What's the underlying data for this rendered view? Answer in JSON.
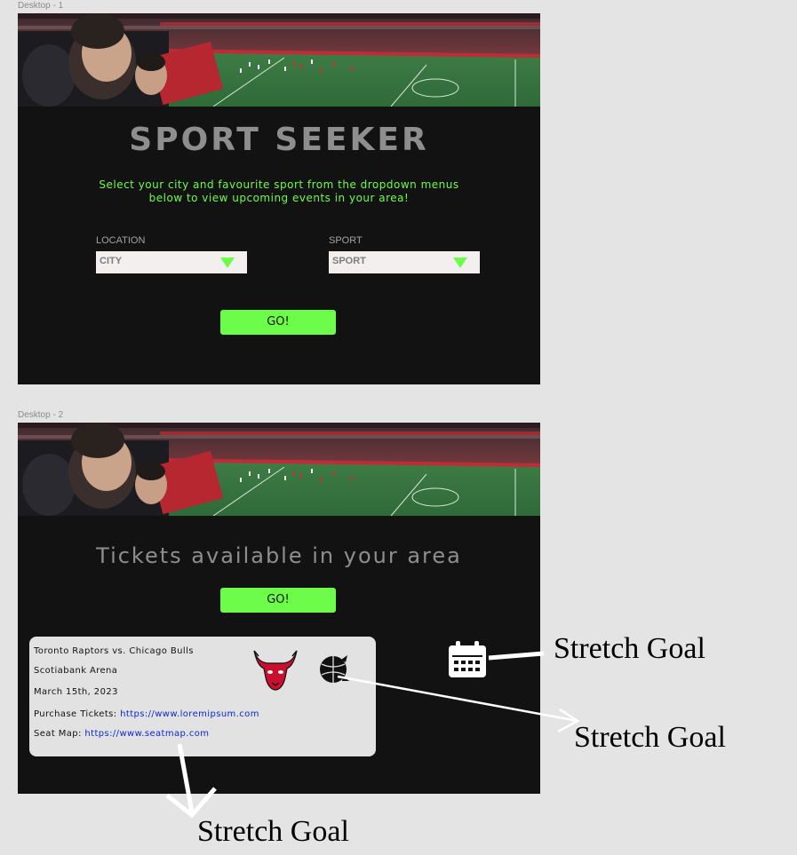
{
  "frames": [
    {
      "label": "Desktop - 1"
    },
    {
      "label": "Desktop - 2"
    }
  ],
  "desktop1": {
    "title": "SPORT SEEKER",
    "intro": "Select your city and favourite sport from the dropdown menus below to view upcoming events in your area!",
    "location": {
      "label": "LOCATION",
      "value": "CITY"
    },
    "sport": {
      "label": "SPORT",
      "value": "SPORT"
    },
    "go_label": "GO!"
  },
  "desktop2": {
    "title": "Tickets available in your area",
    "go_label": "GO!",
    "event": {
      "matchup": "Toronto Raptors vs. Chicago Bulls",
      "venue": "Scotiabank Arena",
      "date": "March 15th, 2023",
      "tickets_label": "Purchase Tickets:",
      "tickets_url": "https://www.loremipsum.com",
      "seatmap_label": "Seat Map:",
      "seatmap_url": "https://www.seatmap.com"
    },
    "icons": [
      "bulls-logo-icon",
      "raptors-logo-icon",
      "calendar-icon"
    ]
  },
  "annotations": [
    {
      "text": "Stretch Goal"
    },
    {
      "text": "Stretch Goal"
    },
    {
      "text": "Stretch Goal"
    }
  ],
  "colors": {
    "accent": "#6efc4a",
    "frame_bg": "#121212",
    "canvas_bg": "#e4e4e4",
    "title_gray": "#8e8e8e",
    "link": "#0b28d8",
    "bulls_red": "#c8102e"
  }
}
